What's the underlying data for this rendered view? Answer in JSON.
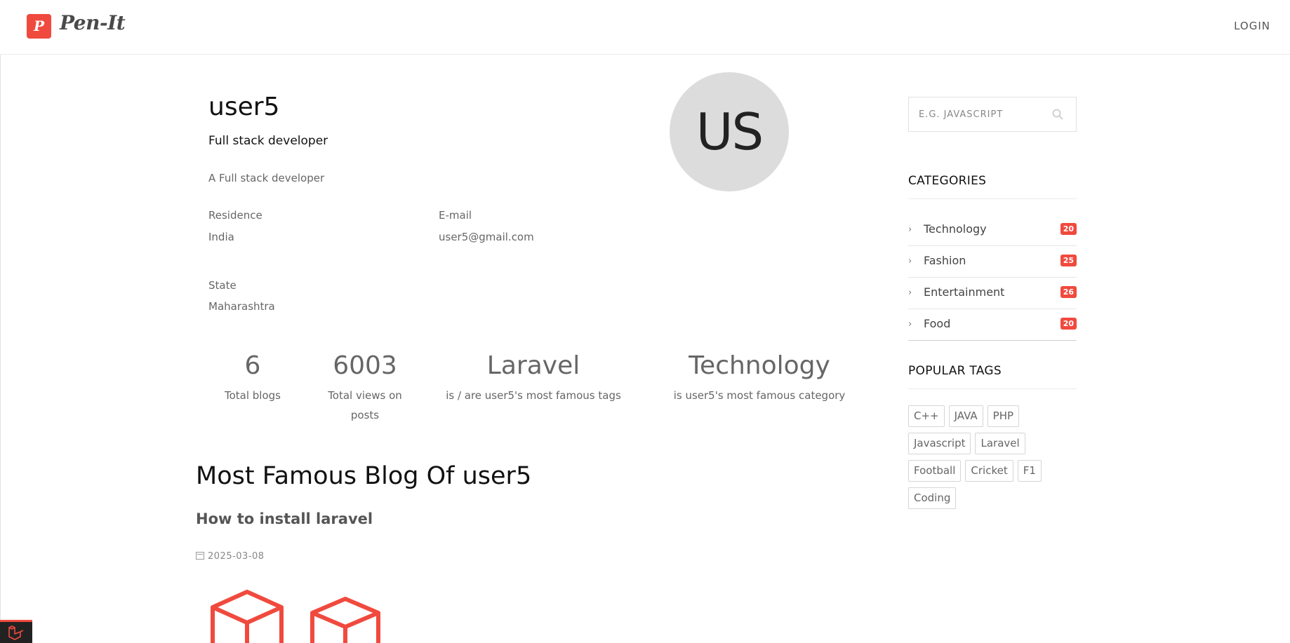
{
  "header": {
    "logo_letter": "P",
    "logo_text": "Pen-It",
    "login": "LOGIN"
  },
  "profile": {
    "username": "user5",
    "role": "Full stack developer",
    "bio": "A Full stack developer",
    "avatar_initials": "US",
    "residence_label": "Residence",
    "residence_value": "India",
    "email_label": "E-mail",
    "email_value": "user5@gmail.com",
    "state_label": "State",
    "state_value": "Maharashtra"
  },
  "stats": {
    "total_blogs_value": "6",
    "total_blogs_label": "Total blogs",
    "total_views_value": "6003",
    "total_views_label": "Total views on posts",
    "famous_tag_value": "Laravel",
    "famous_tag_label": "is / are user5's most famous tags",
    "famous_category_value": "Technology",
    "famous_category_label": "is user5's most famous category"
  },
  "famous_blog": {
    "heading": "Most Famous Blog Of user5",
    "title": "How to install laravel",
    "date": "2025-03-08"
  },
  "sidebar": {
    "search_placeholder": "E.G. JAVASCRIPT",
    "categories_heading": "CATEGORIES",
    "categories": [
      {
        "label": "Technology",
        "count": "20"
      },
      {
        "label": "Fashion",
        "count": "25"
      },
      {
        "label": "Entertainment",
        "count": "26"
      },
      {
        "label": "Food",
        "count": "20"
      }
    ],
    "tags_heading": "POPULAR TAGS",
    "tags": [
      "C++",
      "JAVA",
      "PHP",
      "Javascript",
      "Laravel",
      "Football",
      "Cricket",
      "F1",
      "Coding"
    ]
  },
  "colors": {
    "accent": "#f04a3e",
    "avatar_bg": "#dcdcdc",
    "text_muted": "#666666"
  },
  "icons": {
    "search": "search-icon",
    "calendar": "calendar-icon",
    "chevron": "chevron-right-icon",
    "laravel": "laravel-logo-icon"
  }
}
